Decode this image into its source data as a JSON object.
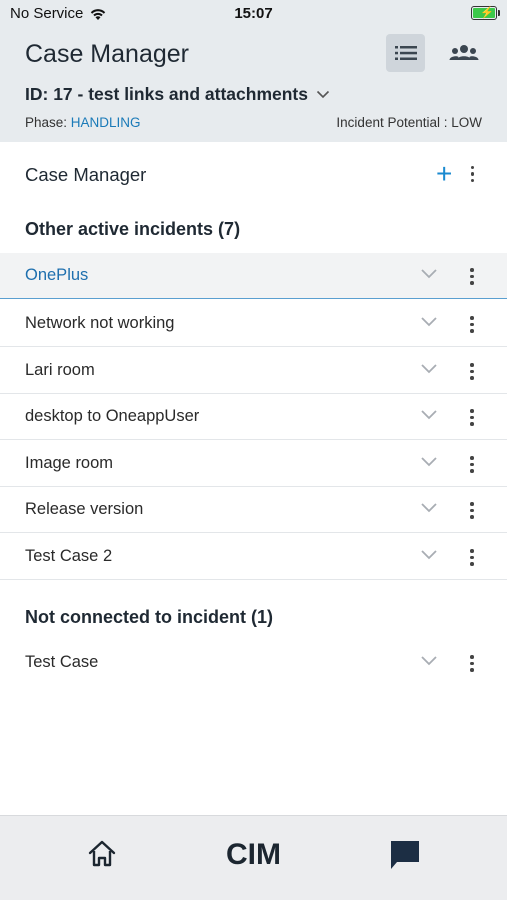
{
  "status_bar": {
    "carrier": "No Service",
    "time": "15:07"
  },
  "header": {
    "app_title": "Case Manager",
    "case_id": "ID: 17 - test links and attachments",
    "phase_label": "Phase:",
    "phase_value": "HANDLING",
    "incident_potential": "Incident Potential : LOW"
  },
  "case_manager": {
    "title": "Case Manager"
  },
  "active_group": {
    "title": "Other active incidents (7)",
    "items": [
      {
        "label": "OnePlus"
      },
      {
        "label": "Network not working"
      },
      {
        "label": "Lari room"
      },
      {
        "label": "desktop to OneappUser"
      },
      {
        "label": "Image room"
      },
      {
        "label": "Release version"
      },
      {
        "label": "Test Case 2"
      }
    ]
  },
  "not_connected_group": {
    "title": "Not connected to incident (1)",
    "items": [
      {
        "label": "Test Case"
      }
    ]
  },
  "bottom_bar": {
    "center_label": "CIM"
  },
  "colors": {
    "accent": "#1a7ab8",
    "header_bg": "#e7ebee",
    "active_row_bg": "#f2f3f4"
  }
}
